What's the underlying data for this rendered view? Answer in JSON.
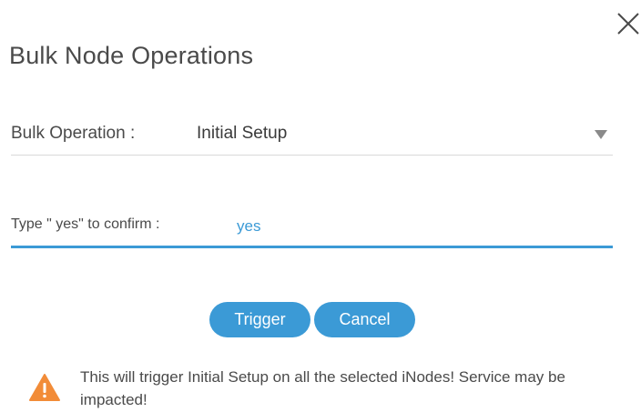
{
  "dialog": {
    "title": "Bulk Node Operations"
  },
  "bulk_operation": {
    "label": "Bulk Operation :",
    "selected": "Initial Setup"
  },
  "confirm": {
    "label": "Type \" yes\"  to confirm :",
    "value": "yes"
  },
  "buttons": {
    "trigger": "Trigger",
    "cancel": "Cancel"
  },
  "warning": {
    "text": "This will trigger Initial Setup on all the selected iNodes! Service may be impacted!"
  },
  "colors": {
    "accent": "#3b9ad6",
    "warning": "#f28c38"
  },
  "icons": {
    "close": "close-icon",
    "caret": "caret-down-icon",
    "warning": "warning-triangle-icon"
  }
}
